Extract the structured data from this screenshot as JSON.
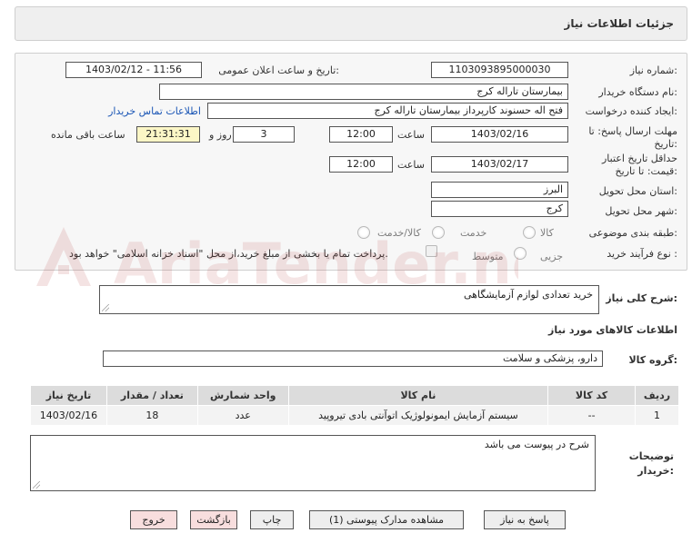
{
  "header": {
    "title": "جزئیات اطلاعات نیاز"
  },
  "form": {
    "need_number": {
      "label": "شماره نیاز:",
      "value": "1103093895000030"
    },
    "announce_datetime": {
      "label": "تاریخ و ساعت اعلان عمومی:",
      "value": "1403/02/12 - 11:56"
    },
    "buyer_org": {
      "label": "نام دستگاه خریدار:",
      "value": "بیمارستان تاراله کرج"
    },
    "requester": {
      "label": "ایجاد کننده درخواست:",
      "value": "فتح اله حسنوند کارپرداز بیمارستان تاراله کرج"
    },
    "contact_link": "اطلاعات تماس خریدار",
    "reply_deadline": {
      "label_line1": "مهلت ارسال پاسخ: تا",
      "label_line2": "تاریخ:",
      "date": "1403/02/16",
      "time_label": "ساعت",
      "time": "12:00",
      "days": "3",
      "days_label": "روز و",
      "remaining": "21:31:31",
      "remaining_label": "ساعت باقی مانده"
    },
    "price_validity": {
      "label_line1": "حداقل تاریخ اعتبار",
      "label_line2": "قیمت: تا تاریخ:",
      "date": "1403/02/17",
      "time_label": "ساعت",
      "time": "12:00"
    },
    "province": {
      "label": "استان محل تحویل:",
      "value": "البرز"
    },
    "city": {
      "label": "شهر محل تحویل:",
      "value": "کرج"
    },
    "category": {
      "label": "طبقه بندی موضوعی:",
      "options": [
        "کالا",
        "خدمت",
        "کالا/خدمت"
      ]
    },
    "purchase_type": {
      "label": "نوع فرآیند خرید :",
      "options": [
        "جزیی",
        "متوسط"
      ],
      "payment_note": "پرداخت تمام یا بخشی از مبلغ خرید،از محل \"اسناد خزانه اسلامی\" خواهد بود."
    }
  },
  "summary": {
    "label": "شرح کلی نیاز:",
    "value": "خرید تعدادی لوازم آزمایشگاهی"
  },
  "goods_section": {
    "title": "اطلاعات کالاهای مورد نیاز",
    "group_label": "گروه کالا:",
    "group_value": "دارو، پزشکی و سلامت"
  },
  "table": {
    "headers": [
      "ردیف",
      "کد کالا",
      "نام کالا",
      "واحد شمارش",
      "تعداد / مقدار",
      "تاریخ نیاز"
    ],
    "rows": [
      [
        "1",
        "--",
        "سیستم آزمایش ایمونولوژیک اتوآنتی بادی تیروپید",
        "عدد",
        "18",
        "1403/02/16"
      ]
    ]
  },
  "buyer_notes": {
    "label_line1": "توضیحات",
    "label_line2": "خریدار:",
    "value": "شرح در پیوست می باشد"
  },
  "buttons": {
    "reply": "پاسخ به نیاز",
    "attachments": "مشاهده مدارک پیوستی (1)",
    "print": "چاپ",
    "back": "بازگشت",
    "exit": "خروج"
  },
  "watermark": {
    "text": "AriaTender.net"
  }
}
